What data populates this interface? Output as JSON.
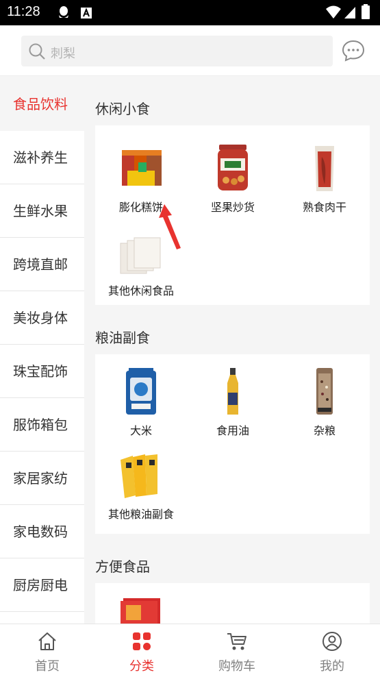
{
  "status_bar": {
    "time": "11:28",
    "icons": [
      "qq-icon",
      "text-a-icon",
      "wifi-icon",
      "signal-icon",
      "battery-icon"
    ]
  },
  "search": {
    "placeholder": "刺梨",
    "icon": "search-icon"
  },
  "header": {
    "message_icon": "chat-bubble-icon"
  },
  "sidebar": {
    "items": [
      {
        "label": "食品饮料",
        "active": true
      },
      {
        "label": "滋补养生",
        "active": false
      },
      {
        "label": "生鲜水果",
        "active": false
      },
      {
        "label": "跨境直邮",
        "active": false
      },
      {
        "label": "美妆身体",
        "active": false
      },
      {
        "label": "珠宝配饰",
        "active": false
      },
      {
        "label": "服饰箱包",
        "active": false
      },
      {
        "label": "家居家纺",
        "active": false
      },
      {
        "label": "家电数码",
        "active": false
      },
      {
        "label": "厨房厨电",
        "active": false
      }
    ]
  },
  "sections": [
    {
      "title": "休闲小食",
      "products": [
        {
          "name": "膨化糕饼",
          "thumb": "snack-boxes-image"
        },
        {
          "name": "坚果炒货",
          "thumb": "nut-jar-image"
        },
        {
          "name": "熟食肉干",
          "thumb": "jerky-pack-image"
        },
        {
          "name": "其他休闲食品",
          "thumb": "gift-boxes-image"
        }
      ]
    },
    {
      "title": "粮油副食",
      "products": [
        {
          "name": "大米",
          "thumb": "rice-bag-image"
        },
        {
          "name": "食用油",
          "thumb": "oil-bottle-image"
        },
        {
          "name": "杂粮",
          "thumb": "grain-bag-image"
        },
        {
          "name": "其他粮油副食",
          "thumb": "noodle-packs-image"
        }
      ]
    },
    {
      "title": "方便食品",
      "products": [
        {
          "name": "",
          "thumb": "red-package-image"
        }
      ]
    }
  ],
  "tabbar": {
    "tabs": [
      {
        "label": "首页",
        "icon": "home-icon",
        "active": false
      },
      {
        "label": "分类",
        "icon": "category-icon",
        "active": true
      },
      {
        "label": "购物车",
        "icon": "cart-icon",
        "active": false
      },
      {
        "label": "我的",
        "icon": "user-icon",
        "active": false
      }
    ]
  },
  "colors": {
    "accent": "#e8332f",
    "background": "#f5f5f5",
    "inactive_text": "#808080"
  }
}
